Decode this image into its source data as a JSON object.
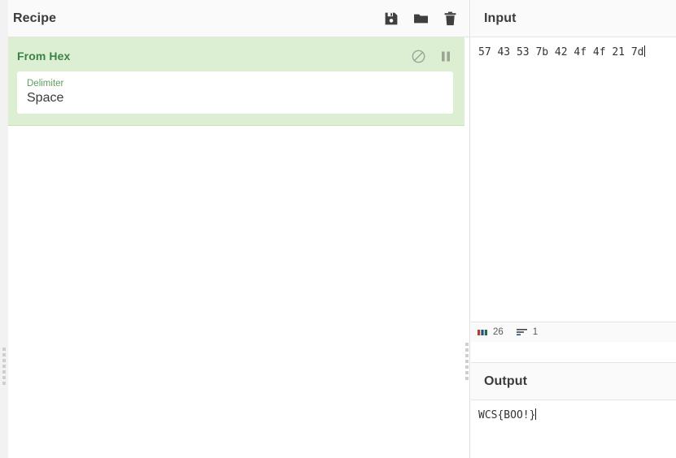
{
  "recipe": {
    "title": "Recipe",
    "actions": [
      {
        "name": "save-recipe-button",
        "icon": "save-icon",
        "label": "Save recipe"
      },
      {
        "name": "load-recipe-button",
        "icon": "folder-icon",
        "label": "Load recipe"
      },
      {
        "name": "clear-recipe-button",
        "icon": "trash-icon",
        "label": "Clear recipe"
      }
    ],
    "operations": [
      {
        "name": "From Hex",
        "disable_label": "Disable operation",
        "breakpoint_label": "Set breakpoint",
        "args": [
          {
            "label": "Delimiter",
            "value": "Space"
          }
        ]
      }
    ]
  },
  "input": {
    "title": "Input",
    "value": "57 43 53 7b 42 4f 4f 21 7d",
    "status": {
      "length_icon": "abc-icon",
      "length": "26",
      "lines_icon": "lines-icon",
      "lines": "1"
    }
  },
  "output": {
    "title": "Output",
    "value": "WCS{BOO!}"
  },
  "colors": {
    "operation_bg": "#ddefd3",
    "operation_title": "#3a8247",
    "arg_label": "#5f9e5f",
    "panel_header_bg": "#fafafa",
    "border": "#e4e4e4"
  }
}
